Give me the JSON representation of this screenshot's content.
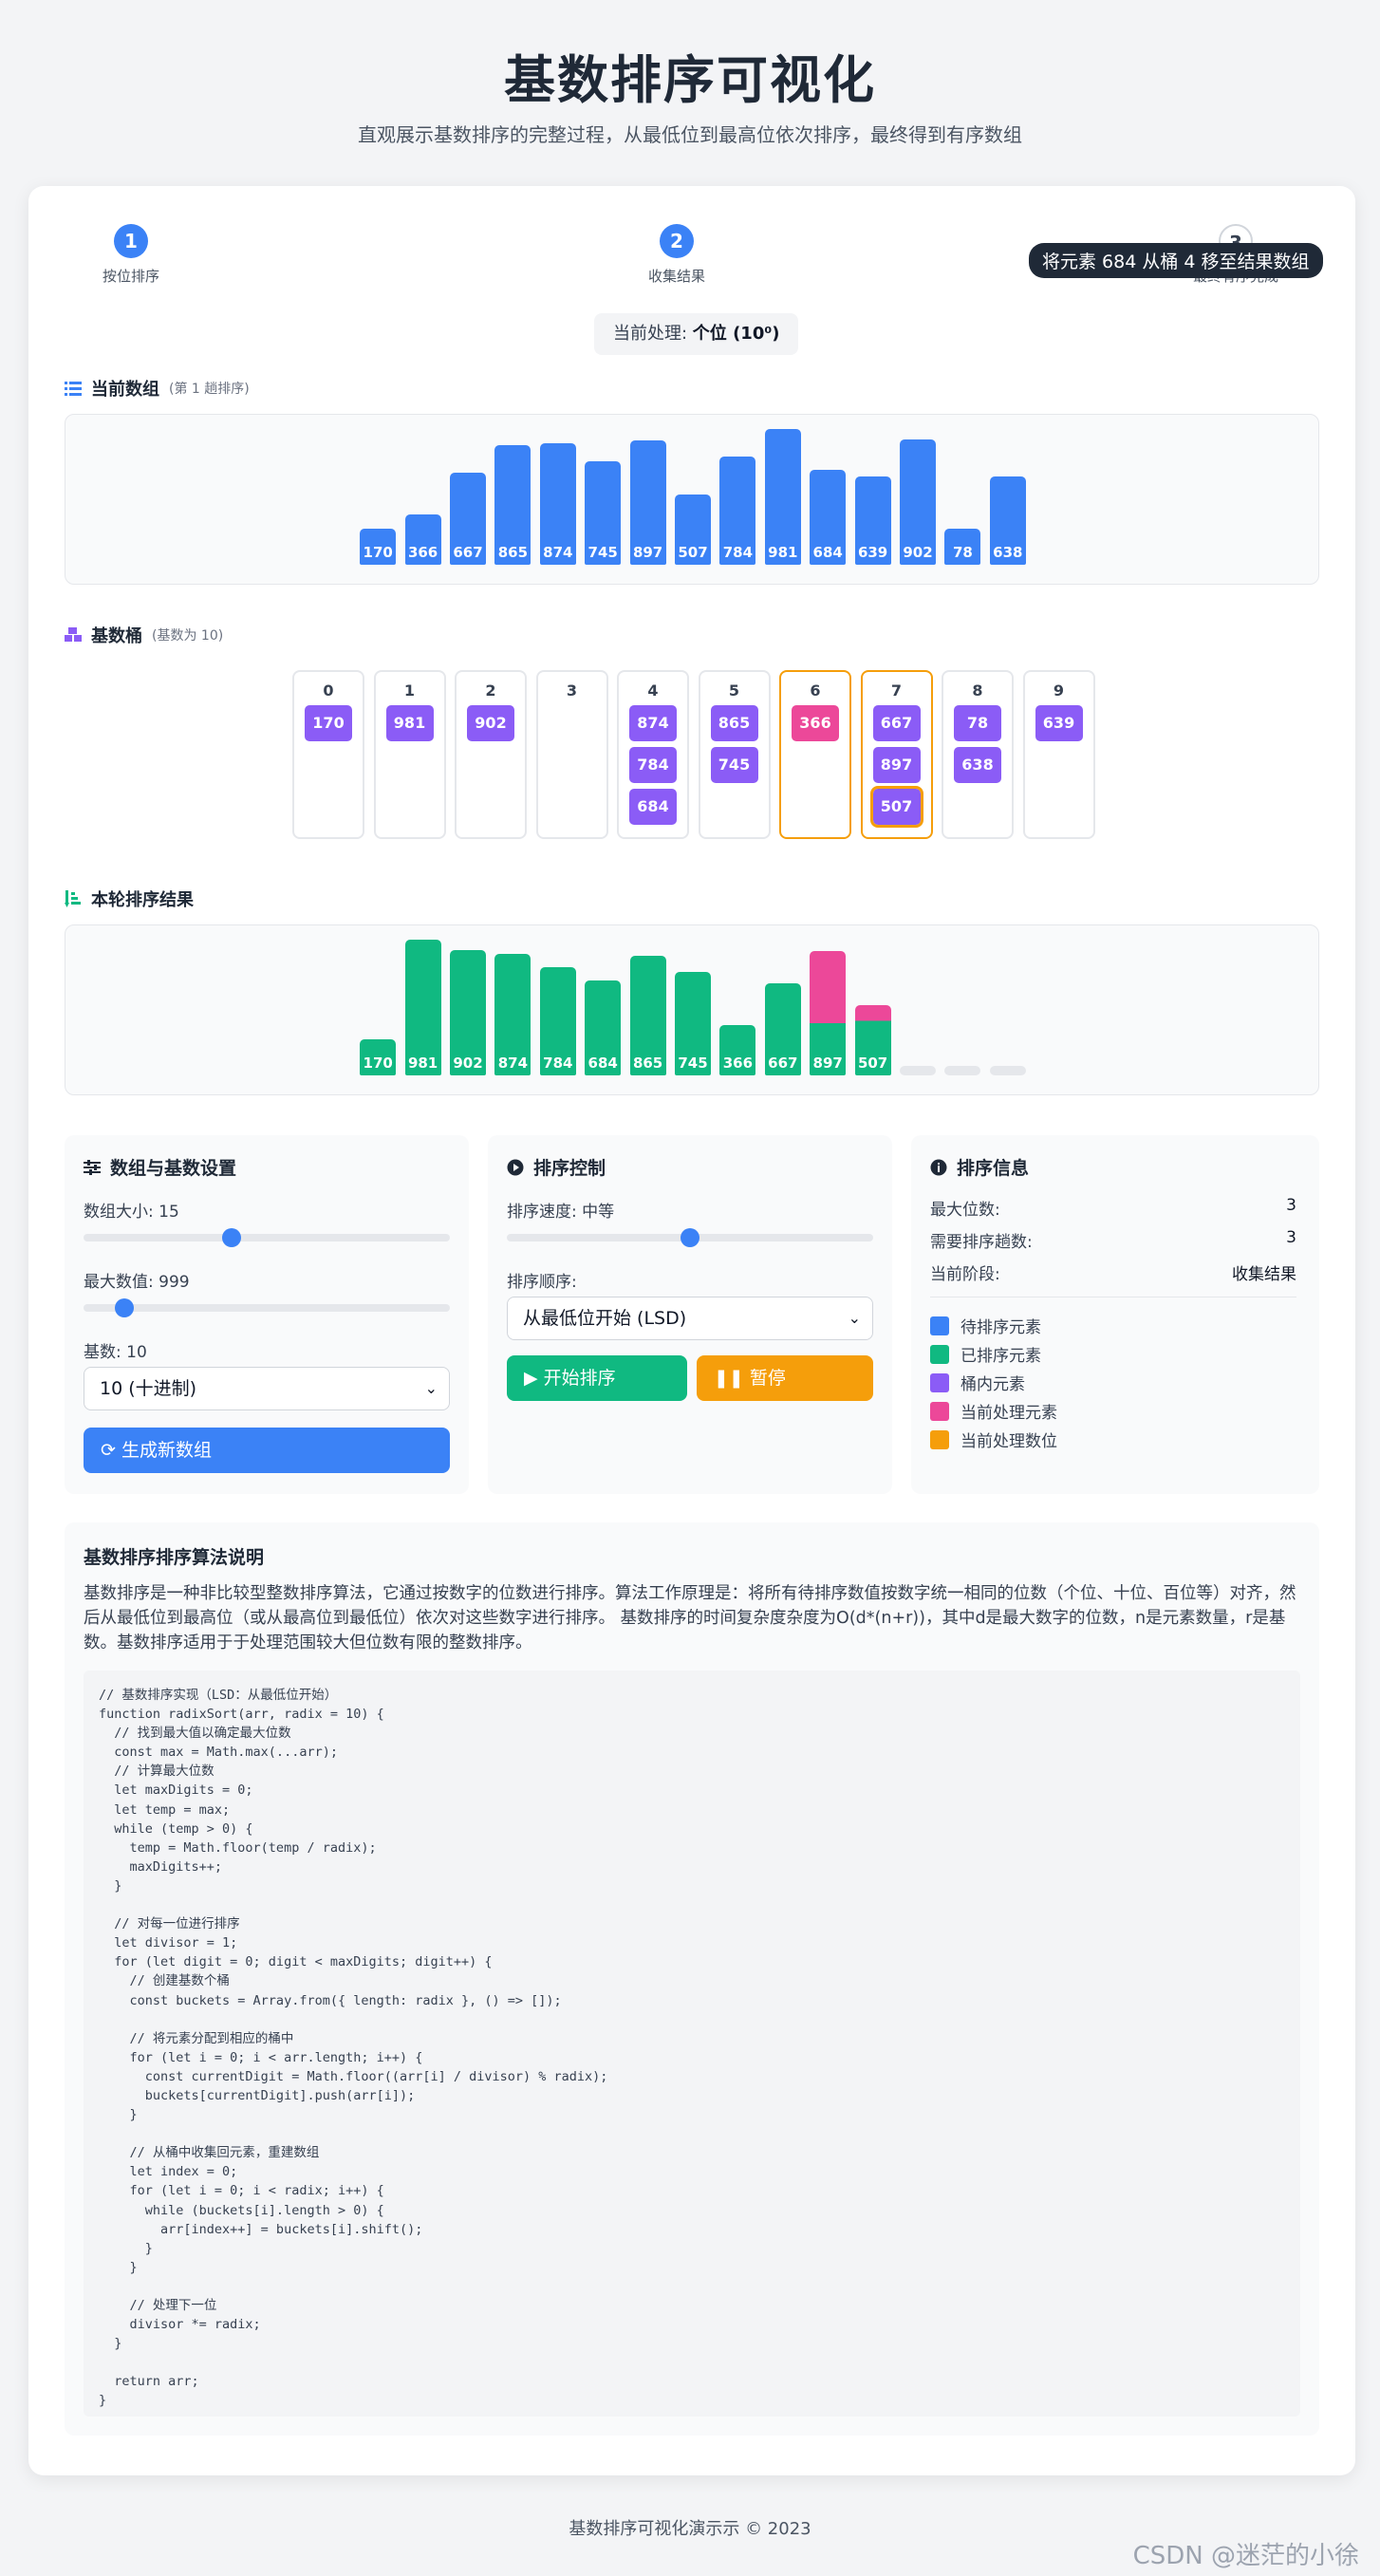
{
  "header": {
    "title": "基数排序可视化",
    "subtitle": "直观展示基数排序的完整过程，从最低位到最高位依次排序，最终得到有序数组"
  },
  "steps": [
    {
      "num": "1",
      "label": "按位排序"
    },
    {
      "num": "2",
      "label": "收集结果"
    },
    {
      "num": "3",
      "label": "最终有序完成"
    }
  ],
  "tooltip": "将元素 684 从桶 4 移至结果数组",
  "current": {
    "prefix": "当前处理: ",
    "value": "个位 (10⁰)"
  },
  "sections": {
    "array_title": "当前数组",
    "array_sub": "(第 1 趟排序)",
    "bucket_title": "基数桶",
    "bucket_sub": "(基数为 10)",
    "result_title": "本轮排序结果"
  },
  "chart_data": [
    {
      "type": "bar",
      "title": "当前数组",
      "categories": [
        "170",
        "366",
        "667",
        "865",
        "874",
        "745",
        "897",
        "507",
        "784",
        "981",
        "684",
        "639",
        "902",
        "78",
        "638"
      ],
      "values": [
        170,
        366,
        667,
        865,
        874,
        745,
        897,
        507,
        784,
        981,
        684,
        639,
        902,
        78,
        638
      ]
    },
    {
      "type": "bar",
      "title": "本轮排序结果",
      "categories": [
        "170",
        "981",
        "902",
        "874",
        "784",
        "684",
        "865",
        "745",
        "366",
        "667",
        "897",
        "507"
      ],
      "values": [
        170,
        981,
        902,
        874,
        784,
        684,
        865,
        745,
        366,
        667,
        897,
        507
      ],
      "empty_slots": 3
    }
  ],
  "buckets": [
    {
      "label": "0",
      "items": [
        "170"
      ]
    },
    {
      "label": "1",
      "items": [
        "981"
      ]
    },
    {
      "label": "2",
      "items": [
        "902"
      ]
    },
    {
      "label": "3",
      "items": []
    },
    {
      "label": "4",
      "items": [
        "874",
        "784",
        "684"
      ]
    },
    {
      "label": "5",
      "items": [
        "865",
        "745"
      ]
    },
    {
      "label": "6",
      "items": [
        "366"
      ]
    },
    {
      "label": "7",
      "items": [
        "667",
        "897",
        "507"
      ]
    },
    {
      "label": "8",
      "items": [
        "78",
        "638"
      ]
    },
    {
      "label": "9",
      "items": [
        "639"
      ]
    }
  ],
  "settings": {
    "title": "数组与基数设置",
    "size_label": "数组大小: 15",
    "size_value": 15,
    "size_range": [
      5,
      30
    ],
    "max_label": "最大数值: 999",
    "max_value": 999,
    "max_range": [
      99,
      9999
    ],
    "radix_label": "基数: 10",
    "radix_select": "10 (十进制)",
    "generate_button": "生成新数组"
  },
  "control": {
    "title": "排序控制",
    "speed_label": "排序速度: 中等",
    "speed_fraction": 0.5,
    "order_label": "排序顺序:",
    "order_select": "从最低位开始 (LSD)",
    "start_button": "开始排序",
    "pause_button": "暂停"
  },
  "info": {
    "title": "排序信息",
    "rows": [
      {
        "k": "最大位数:",
        "v": "3"
      },
      {
        "k": "需要排序趟数:",
        "v": "3"
      },
      {
        "k": "当前阶段:",
        "v": "收集结果"
      }
    ],
    "legend": [
      {
        "label": "待排序元素",
        "color": "#3b82f6"
      },
      {
        "label": "已排序元素",
        "color": "#10b981"
      },
      {
        "label": "桶内元素",
        "color": "#8b5cf6"
      },
      {
        "label": "当前处理元素",
        "color": "#ec4899"
      },
      {
        "label": "当前处理数位",
        "color": "#f59e0b"
      }
    ]
  },
  "explain": {
    "title": "基数排序排序算法说明",
    "text": "基数排序是一种非比较型整数排序算法，它通过按数字的位数进行排序。算法工作原理是：将所有待排序数值按数字统一相同的位数（个位、十位、百位等）对齐，然后从最低位到最高位（或从最高位到最低位）依次对这些数字进行排序。 基数排序的时间复杂度杂度为O(d*(n+r))，其中d是最大数字的位数，n是元素数量，r是基数。基数排序适用于于处理范围较大但位数有限的整数排序。",
    "code": "// 基数排序实现（LSD：从最低位开始）\nfunction radixSort(arr, radix = 10) {\n  // 找到最大值以确定最大位数\n  const max = Math.max(...arr);\n  // 计算最大位数\n  let maxDigits = 0;\n  let temp = max;\n  while (temp > 0) {\n    temp = Math.floor(temp / radix);\n    maxDigits++;\n  }\n\n  // 对每一位进行排序\n  let divisor = 1;\n  for (let digit = 0; digit < maxDigits; digit++) {\n    // 创建基数个桶\n    const buckets = Array.from({ length: radix }, () => []);\n\n    // 将元素分配到相应的桶中\n    for (let i = 0; i < arr.length; i++) {\n      const currentDigit = Math.floor((arr[i] / divisor) % radix);\n      buckets[currentDigit].push(arr[i]);\n    }\n\n    // 从桶中收集回元素，重建数组\n    let index = 0;\n    for (let i = 0; i < radix; i++) {\n      while (buckets[i].length > 0) {\n        arr[index++] = buckets[i].shift();\n      }\n    }\n\n    // 处理下一位\n    divisor *= radix;\n  }\n\n  return arr;\n}"
  },
  "footer": "基数排序可视化演示示 © 2023",
  "watermark": "CSDN @迷茫的小徐"
}
